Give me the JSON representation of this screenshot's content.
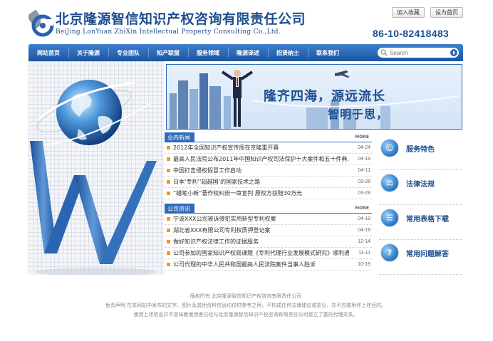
{
  "header": {
    "company_cn": "北京隆源智信知识产权咨询有限责任公司",
    "company_en": "BeiJing LonYuan ZhiXin Intellectual Property Consulting Co.,Ltd.",
    "add_favorite": "加入收藏",
    "set_homepage": "设为首页",
    "phone": "86-10-82418483"
  },
  "nav": {
    "items": [
      "网站首页",
      "关于隆源",
      "专业团队",
      "知产联盟",
      "服务领域",
      "隆源译述",
      "招贤纳士",
      "联系我们"
    ],
    "search_placeholder": "Search"
  },
  "banner": {
    "slogan_1": "隆齐四海，源远流长",
    "slogan_2": "智明于思，"
  },
  "news_industry": {
    "tab": "业内新闻",
    "more": "MORE",
    "items": [
      {
        "title": "2012年全国知识产权宣传周在京隆重开幕",
        "date": "04-24"
      },
      {
        "title": "最高人民法院公布2011年中国知识产权司法保护十大案件和五十件典...",
        "date": "04-19"
      },
      {
        "title": "中国打击侵权假冒工作启动",
        "date": "04-11"
      },
      {
        "title": "日本‘专利’‘超越国’的国家技术之路",
        "date": "03-28"
      },
      {
        "title": "“蜡笔小新”著作权纠纷一审宣判 原权方获赔30万元",
        "date": "03-28"
      }
    ]
  },
  "news_company": {
    "tab": "公司资讯",
    "more": "MORE",
    "items": [
      {
        "title": "宁波XXX公司被诉侵犯实用新型专利权案",
        "date": "04-19"
      },
      {
        "title": "湖北省XXX有限公司专利权质押登记案",
        "date": "04-19"
      },
      {
        "title": "做好知识产权法律工作的证据服务",
        "date": "12-14"
      },
      {
        "title": "公司参加的国家知识产权局课题《专利代理行业发展模式研究》顺利通...",
        "date": "11-11"
      },
      {
        "title": "公司代理的中华人民共和国最高人民法院案件当事人胜诉",
        "date": "10-19"
      }
    ]
  },
  "services": [
    {
      "label": "服务特色",
      "icon": "people-icon"
    },
    {
      "label": "法律法规",
      "icon": "scale-icon"
    },
    {
      "label": "常用表格下载",
      "icon": "document-icon"
    },
    {
      "label": "常用问题解答",
      "icon": "question-icon"
    }
  ],
  "footer": {
    "copyright": "版权所有 北京隆源智信知识产权咨询有限责任公司",
    "disclaimer_1": "免责声明 在本网站中发布的文字、图片及其他资料信息均仅供参考之用，不构成任何法律建议或意见，亦不应被用作上述目的。",
    "disclaimer_2": "使用上述信息并不意味着使用者已经与北京隆源智信知识产权咨询有限责任公司建立了委托代理关系。"
  },
  "colors": {
    "brand_blue": "#1d4e8f",
    "nav_blue": "#2f6bb8",
    "bullet_orange": "#f09a1e"
  }
}
